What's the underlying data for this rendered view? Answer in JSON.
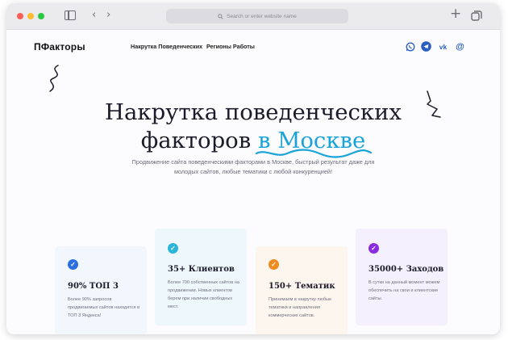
{
  "browser": {
    "url_placeholder": "Search or enter website name",
    "search_icon": "magnifier",
    "add_tab_icon": "+",
    "tabs_icon": "tabs-overview"
  },
  "header": {
    "logo": "ПФакторы",
    "nav": [
      "Накрутка Поведенческих",
      "Регионы Работы"
    ],
    "social": [
      "whatsapp-icon",
      "telegram-icon",
      "vk-icon",
      "email-icon"
    ]
  },
  "hero": {
    "title_line1": "Накрутка поведенческих",
    "title_line2": "факторов",
    "title_accent": "в Москве",
    "subtitle": "Продвижение сайта поведенческими факторами в Москве, быстрый результат даже для молодых сайтов, любые тематики с любой конкуренцией!"
  },
  "cards": [
    {
      "title": "90% ТОП 3",
      "text": "Более 90% запросов продвигаемых сайтов находятся в ТОП 3 Яндекса!",
      "color": "#2c6fe0"
    },
    {
      "title": "35+ Клиентов",
      "text": "Более 700 собственных сайтов на продвижении. Новых клиентов берем при наличии свободных мест.",
      "color": "#2bb5d8"
    },
    {
      "title": "150+ Тематик",
      "text": "Принимаем в накрутку любые тематики и направления коммерческих сайтов.",
      "color": "#f08c1f"
    },
    {
      "title": "35000+ Заходов",
      "text": "В сутки на данный момент можем обеспечить на свои и клиентские сайты.",
      "color": "#8b2be0"
    }
  ],
  "colors": {
    "accent": "#1aa3d6"
  }
}
